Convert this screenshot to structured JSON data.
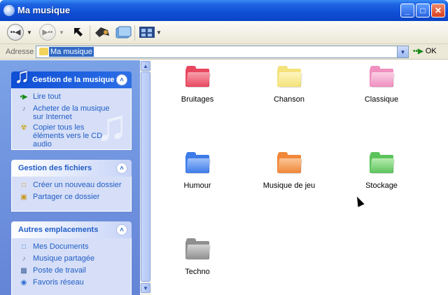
{
  "window": {
    "title": "Ma musique",
    "minimize_label": "_",
    "maximize_label": "□",
    "close_label": "✕"
  },
  "toolbar": {
    "back_icon": "back-arrow-icon",
    "forward_icon": "forward-arrow-icon",
    "up_icon": "up-arrow-icon",
    "search_icon": "search-icon",
    "folders_icon": "folders-icon",
    "views_icon": "views-icon"
  },
  "address": {
    "label": "Adresse",
    "value": "Ma musique",
    "go_label": "OK"
  },
  "sidebar": {
    "panels": [
      {
        "title": "Gestion de la musique",
        "items": [
          {
            "label": "Lire tout",
            "icon": "play-icon"
          },
          {
            "label": "Acheter de la musique sur Internet",
            "icon": "music-shop-icon"
          },
          {
            "label": "Copier tous les éléments vers le CD audio",
            "icon": "cd-burn-icon"
          }
        ]
      },
      {
        "title": "Gestion des fichiers",
        "items": [
          {
            "label": "Créer un nouveau dossier",
            "icon": "new-folder-icon"
          },
          {
            "label": "Partager ce dossier",
            "icon": "share-folder-icon"
          }
        ]
      },
      {
        "title": "Autres emplacements",
        "items": [
          {
            "label": "Mes Documents",
            "icon": "documents-icon"
          },
          {
            "label": "Musique partagée",
            "icon": "shared-music-icon"
          },
          {
            "label": "Poste de travail",
            "icon": "computer-icon"
          },
          {
            "label": "Favoris réseau",
            "icon": "network-icon"
          }
        ]
      }
    ]
  },
  "folders": [
    {
      "name": "Bruitages",
      "color": "#e8475f",
      "light": "#f8a0ad"
    },
    {
      "name": "Chanson",
      "color": "#f4e27a",
      "light": "#fdf5bf"
    },
    {
      "name": "Classique",
      "color": "#f08fc0",
      "light": "#fbd0e6"
    },
    {
      "name": "Humour",
      "color": "#3d7be8",
      "light": "#9ec0fb"
    },
    {
      "name": "Musique de jeu",
      "color": "#f0873a",
      "light": "#fbc596"
    },
    {
      "name": "Stockage",
      "color": "#5cc35c",
      "light": "#b6ecb0"
    },
    {
      "name": "Techno",
      "color": "#8f8f8f",
      "light": "#d4d4d4"
    }
  ]
}
